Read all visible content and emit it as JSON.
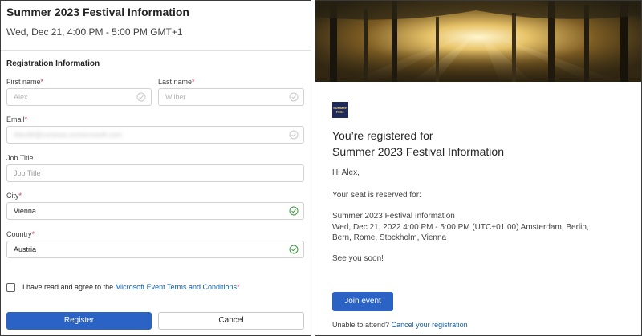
{
  "form": {
    "event_title": "Summer 2023 Festival Information",
    "event_datetime": "Wed, Dec 21, 4:00 PM - 5:00 PM GMT+1",
    "section_heading": "Registration Information",
    "required_mark": "*",
    "fields": {
      "first_name": {
        "label": "First name",
        "value": "Alex"
      },
      "last_name": {
        "label": "Last name",
        "value": "Wilber"
      },
      "email": {
        "label": "Email",
        "value": "AlexW@contoso.onmicrosoft.com"
      },
      "job_title": {
        "label": "Job Title",
        "placeholder": "Job Title"
      },
      "city": {
        "label": "City",
        "value": "Vienna"
      },
      "country": {
        "label": "Country",
        "value": "Austria"
      }
    },
    "consent": {
      "text": "I have read and agree to the",
      "link": "Microsoft Event Terms and Conditions"
    },
    "register_label": "Register",
    "cancel_label": "Cancel"
  },
  "email": {
    "logo_text": "SUMMER FEST",
    "headline_line1": "You’re registered for",
    "headline_line2": "Summer 2023 Festival Information",
    "greeting": "Hi Alex,",
    "reserved": "Your seat is reserved for:",
    "detail_name": "Summer 2023 Festival Information",
    "detail_line2": "Wed, Dec 21, 2022 4:00 PM - 5:00 PM (UTC+01:00) Amsterdam, Berlin,",
    "detail_line3": "Bern, Rome, Stockholm, Vienna",
    "see_you": "See you soon!",
    "join_label": "Join event",
    "unable_text": "Unable to attend?",
    "cancel_link": "Cancel your registration"
  },
  "colors": {
    "primary": "#2b63c5",
    "link": "#115ea3",
    "required": "#c4314b",
    "success": "#3a9a3a"
  }
}
